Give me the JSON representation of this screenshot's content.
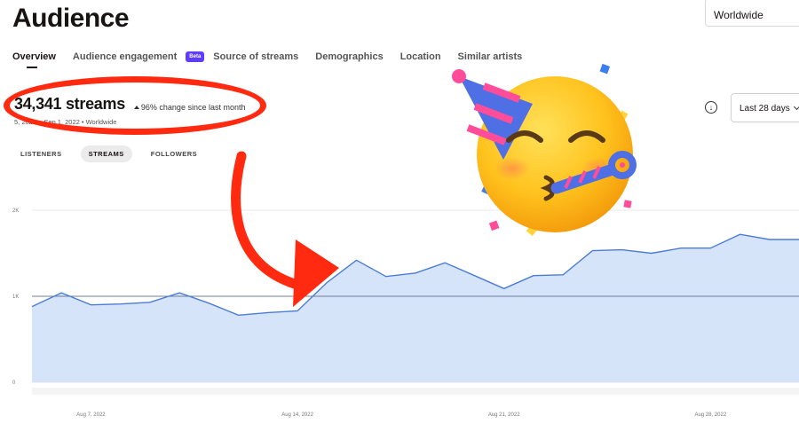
{
  "header": {
    "title": "Audience",
    "location": "Worldwide"
  },
  "tabs": [
    {
      "label": "Overview",
      "active": true
    },
    {
      "label": "Audience engagement",
      "active": false,
      "badge": "Beta"
    },
    {
      "label": "Source of streams",
      "active": false
    },
    {
      "label": "Demographics",
      "active": false
    },
    {
      "label": "Location",
      "active": false
    },
    {
      "label": "Similar artists",
      "active": false
    }
  ],
  "stats": {
    "value": "34,341 streams",
    "change": "96% change since last month",
    "date_range": "5, 2022 – Sep 1, 2022 • Worldwide"
  },
  "toggles": [
    {
      "label": "LISTENERS",
      "active": false
    },
    {
      "label": "STREAMS",
      "active": true
    },
    {
      "label": "FOLLOWERS",
      "active": false
    }
  ],
  "controls": {
    "range": "Last 28 days",
    "download_icon": "download-icon",
    "chevron_icon": "chevron-down-icon"
  },
  "annotations": {
    "emoji": "party-face-emoji",
    "circle_color": "#ff2a10",
    "arrow_color": "#ff2a10"
  },
  "colors": {
    "line": "#4a7cd6",
    "fill": "#d6e4fa",
    "grid": "#e8e8e8",
    "accent": "#5f3dff"
  },
  "chart_data": {
    "type": "area",
    "y_ticks": [
      "0",
      "1K",
      "2K"
    ],
    "ylim": [
      0,
      2000
    ],
    "reference_line": 1000,
    "x_ticks": [
      "Aug 7, 2022",
      "Aug 14, 2022",
      "Aug 21, 2022",
      "Aug 28, 2022"
    ],
    "x_tick_index": [
      2,
      9,
      16,
      23
    ],
    "series": [
      {
        "values": [
          880,
          1040,
          900,
          910,
          930,
          1040,
          920,
          780,
          810,
          830,
          1160,
          1420,
          1230,
          1270,
          1390,
          1240,
          1090,
          1240,
          1250,
          1530,
          1540,
          1500,
          1560,
          1560,
          1720,
          1660,
          1660
        ]
      }
    ]
  }
}
